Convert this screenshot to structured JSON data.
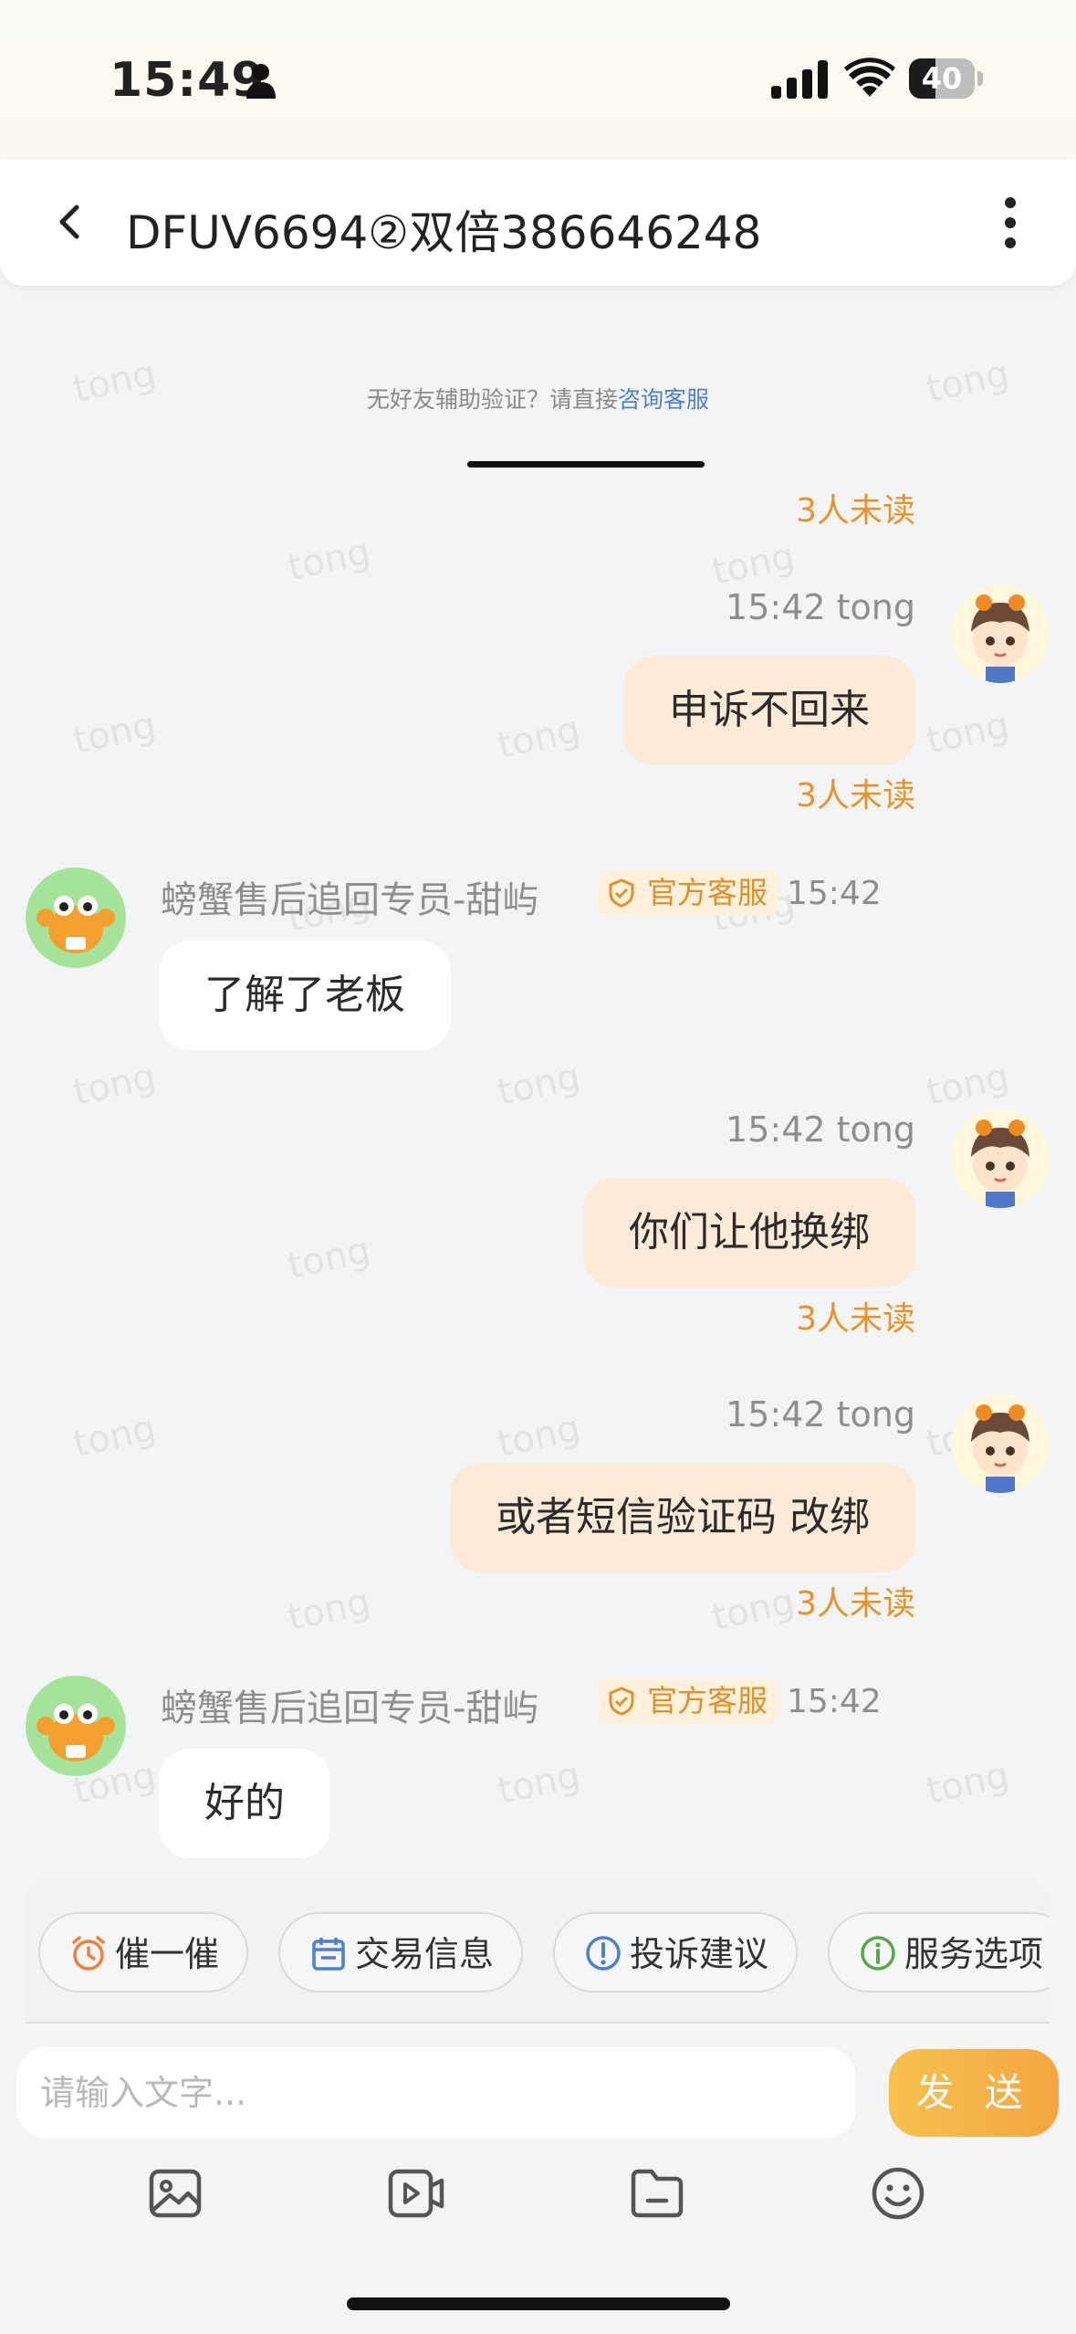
{
  "status_bar": {
    "time": "15:49",
    "battery": "40",
    "battery_level": 0.4
  },
  "header": {
    "title": "DFUV6694②双倍386646248"
  },
  "watermark_text": "tong",
  "notice": {
    "text": "无好友辅助验证？请直接",
    "link": "咨询客服"
  },
  "messages": [
    {
      "type": "unread_only",
      "unread": "3人未读"
    },
    {
      "type": "out",
      "time_user": "15:42 tong",
      "text": "申诉不回来",
      "unread": "3人未读"
    },
    {
      "type": "in",
      "sender": "螃蟹售后追回专员-甜屿",
      "badge": "官方客服",
      "time": "15:42",
      "text": "了解了老板"
    },
    {
      "type": "out",
      "time_user": "15:42 tong",
      "text": "你们让他换绑",
      "unread": "3人未读"
    },
    {
      "type": "out",
      "time_user": "15:42 tong",
      "text": "或者短信验证码 改绑",
      "unread": "3人未读"
    },
    {
      "type": "in",
      "sender": "螃蟹售后追回专员-甜屿",
      "badge": "官方客服",
      "time": "15:42",
      "text": "好的"
    }
  ],
  "quick_actions": [
    {
      "label": "催一催",
      "icon": "alarm-clock-icon"
    },
    {
      "label": "交易信息",
      "icon": "calendar-icon"
    },
    {
      "label": "投诉建议",
      "icon": "exclamation-icon"
    },
    {
      "label": "服务选项",
      "icon": "info-icon"
    }
  ],
  "composer": {
    "placeholder": "请输入文字...",
    "send_label": "发 送"
  },
  "toolbar": [
    "image-icon",
    "video-icon",
    "folder-icon",
    "emoji-icon"
  ],
  "colors": {
    "accent_orange": "#e8932a",
    "link_blue": "#4f7fcf",
    "bubble_out": "#fdebd8"
  }
}
